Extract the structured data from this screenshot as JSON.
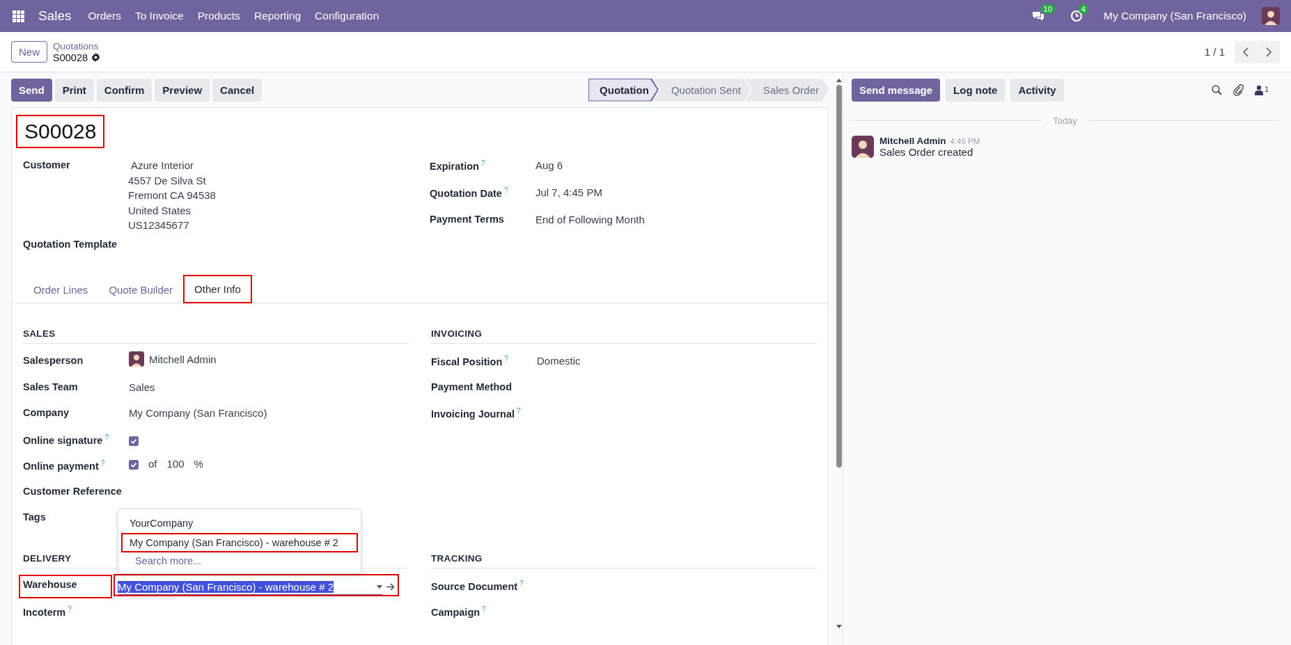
{
  "navbar": {
    "app": "Sales",
    "menu": [
      "Orders",
      "To Invoice",
      "Products",
      "Reporting",
      "Configuration"
    ],
    "messages_badge": "10",
    "activities_badge": "4",
    "company": "My Company (San Francisco)"
  },
  "control_panel": {
    "new_button": "New",
    "breadcrumb": "Quotations",
    "record": "S00028",
    "pager": "1 / 1"
  },
  "actions": [
    {
      "label": "Send",
      "primary": true
    },
    {
      "label": "Print",
      "primary": false
    },
    {
      "label": "Confirm",
      "primary": false
    },
    {
      "label": "Preview",
      "primary": false
    },
    {
      "label": "Cancel",
      "primary": false
    }
  ],
  "statusbar": [
    {
      "label": "Quotation",
      "selected": true
    },
    {
      "label": "Quotation Sent",
      "selected": false
    },
    {
      "label": "Sales Order",
      "selected": false
    }
  ],
  "form": {
    "title": "S00028",
    "title_annotated": true,
    "main_left": [
      {
        "kind": "address",
        "label": "Customer",
        "lines": [
          "Azure Interior",
          "4557 De Silva St",
          "Fremont CA 94538",
          "United States",
          "US12345677"
        ]
      },
      {
        "kind": "empty",
        "label": "Quotation Template"
      }
    ],
    "main_right": [
      {
        "kind": "text",
        "label": "Expiration",
        "help": "?",
        "value": "Aug 6"
      },
      {
        "kind": "text",
        "label": "Quotation Date",
        "help": "?",
        "value": "Jul 7, 4:45 PM"
      },
      {
        "kind": "text",
        "label": "Payment Terms",
        "value": "End of Following Month"
      }
    ],
    "tabs": [
      {
        "label": "Order Lines",
        "selected": false,
        "annotated": false
      },
      {
        "label": "Quote Builder",
        "selected": false,
        "annotated": false
      },
      {
        "label": "Other Info",
        "selected": true,
        "annotated": true
      }
    ],
    "sections": [
      {
        "title": "SALES",
        "fields": [
          {
            "kind": "avatar",
            "label": "Salesperson",
            "value": "Mitchell Admin"
          },
          {
            "kind": "text",
            "label": "Sales Team",
            "value": "Sales"
          },
          {
            "kind": "text",
            "label": "Company",
            "value": "My Company (San Francisco)"
          },
          {
            "kind": "checkbox",
            "label": "Online signature",
            "help": "?",
            "checked": true
          },
          {
            "kind": "percent",
            "label": "Online payment",
            "help": "?",
            "checked": true,
            "of": "of",
            "value": "100",
            "unit": "%"
          },
          {
            "kind": "empty",
            "label": "Customer Reference"
          },
          {
            "kind": "empty",
            "label": "Tags"
          }
        ]
      },
      {
        "title": "INVOICING",
        "fields": [
          {
            "kind": "text",
            "label": "Fiscal Position",
            "help": "?",
            "value": "Domestic"
          },
          {
            "kind": "empty",
            "label": "Payment Method"
          },
          {
            "kind": "empty",
            "label": "Invoicing Journal",
            "help": "?"
          }
        ]
      },
      {
        "title": "DELIVERY",
        "fields": [
          {
            "kind": "many2one",
            "label": "Warehouse",
            "annotated": true,
            "value": "My Company (San Francisco) - warehouse # 2",
            "dropdown": {
              "options": [
                {
                  "label": "YourCompany",
                  "annotated": false
                },
                {
                  "label": "My Company (San Francisco) - warehouse # 2",
                  "annotated": true
                }
              ],
              "search_more": "Search more..."
            }
          },
          {
            "kind": "empty",
            "label": "Incoterm",
            "help": "?"
          }
        ]
      },
      {
        "title": "TRACKING",
        "fields": [
          {
            "kind": "empty",
            "label": "Source Document",
            "help": "?"
          },
          {
            "kind": "empty",
            "label": "Campaign",
            "help": "?"
          }
        ]
      }
    ]
  },
  "chatter": {
    "buttons": [
      {
        "label": "Send message",
        "primary": true
      },
      {
        "label": "Log note",
        "primary": false
      },
      {
        "label": "Activity",
        "primary": false
      }
    ],
    "followers": "1",
    "separator": "Today",
    "messages": [
      {
        "author": "Mitchell Admin",
        "time": "4:45 PM",
        "body": "Sales Order created"
      }
    ]
  }
}
